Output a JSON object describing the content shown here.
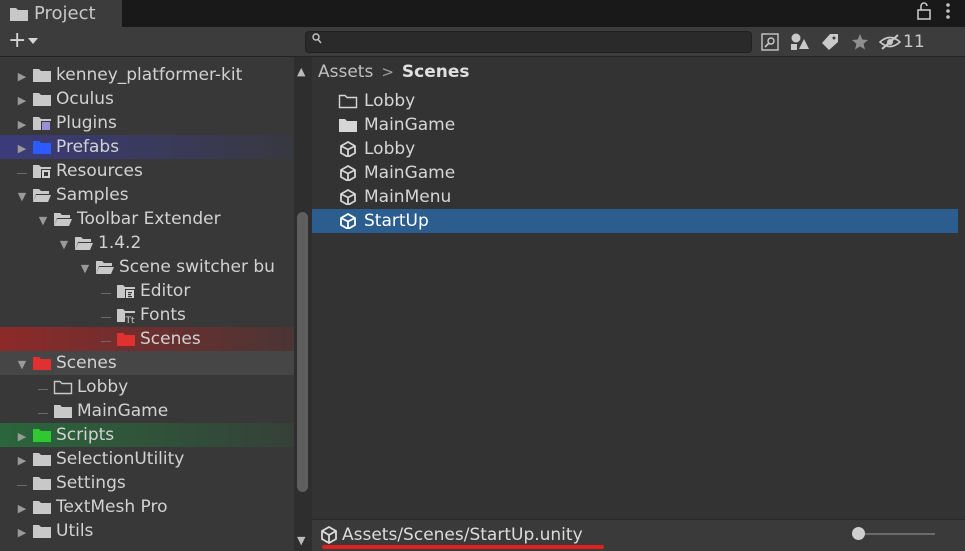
{
  "window": {
    "tab_title": "Project"
  },
  "toolbar": {
    "add_label": "+",
    "hidden_count": "11"
  },
  "search": {
    "placeholder": ""
  },
  "tree": {
    "items": [
      {
        "label": "kenney_platformer-kit",
        "depth": 0,
        "arrow": "right",
        "icon": "folder",
        "color": "#c8c8c8"
      },
      {
        "label": "Oculus",
        "depth": 0,
        "arrow": "right",
        "icon": "folder",
        "color": "#c8c8c8"
      },
      {
        "label": "Plugins",
        "depth": 0,
        "arrow": "right",
        "icon": "plugins-folder",
        "color": "#c8c8c8"
      },
      {
        "label": "Prefabs",
        "depth": 0,
        "arrow": "right",
        "icon": "folder",
        "color": "#2c5cff",
        "highlight": "blue"
      },
      {
        "label": "Resources",
        "depth": 0,
        "arrow": "none",
        "icon": "resources-folder",
        "color": "#c8c8c8"
      },
      {
        "label": "Samples",
        "depth": 0,
        "arrow": "down",
        "icon": "open-folder",
        "color": "#c8c8c8"
      },
      {
        "label": "Toolbar Extender",
        "depth": 1,
        "arrow": "down",
        "icon": "open-folder",
        "color": "#c8c8c8"
      },
      {
        "label": "1.4.2",
        "depth": 2,
        "arrow": "down",
        "icon": "open-folder",
        "color": "#c8c8c8"
      },
      {
        "label": "Scene switcher bu",
        "depth": 3,
        "arrow": "down",
        "icon": "open-folder",
        "color": "#c8c8c8"
      },
      {
        "label": "Editor",
        "depth": 4,
        "arrow": "none",
        "icon": "editor-folder",
        "color": "#c8c8c8"
      },
      {
        "label": "Fonts",
        "depth": 4,
        "arrow": "none",
        "icon": "fonts-folder",
        "color": "#c8c8c8"
      },
      {
        "label": "Scenes",
        "depth": 4,
        "arrow": "none",
        "icon": "folder",
        "color": "#e03030",
        "highlight": "red"
      },
      {
        "label": "Scenes",
        "depth": 0,
        "arrow": "down",
        "icon": "folder",
        "color": "#e03030",
        "highlight": "gray"
      },
      {
        "label": "Lobby",
        "depth": 1,
        "arrow": "none",
        "icon": "empty-folder",
        "color": "#c8c8c8"
      },
      {
        "label": "MainGame",
        "depth": 1,
        "arrow": "none",
        "icon": "folder",
        "color": "#c8c8c8"
      },
      {
        "label": "Scripts",
        "depth": 0,
        "arrow": "right",
        "icon": "folder",
        "color": "#30c830",
        "highlight": "green"
      },
      {
        "label": "SelectionUtility",
        "depth": 0,
        "arrow": "right",
        "icon": "folder",
        "color": "#c8c8c8"
      },
      {
        "label": "Settings",
        "depth": 0,
        "arrow": "none",
        "icon": "folder",
        "color": "#c8c8c8"
      },
      {
        "label": "TextMesh Pro",
        "depth": 0,
        "arrow": "right",
        "icon": "folder",
        "color": "#c8c8c8"
      },
      {
        "label": "Utils",
        "depth": 0,
        "arrow": "right",
        "icon": "folder",
        "color": "#c8c8c8"
      }
    ]
  },
  "breadcrumb": {
    "root": "Assets",
    "separator": ">",
    "current": "Scenes"
  },
  "assets": [
    {
      "label": "Lobby",
      "icon": "empty-folder",
      "selected": false
    },
    {
      "label": "MainGame",
      "icon": "folder",
      "selected": false
    },
    {
      "label": "Lobby",
      "icon": "unity-scene",
      "selected": false
    },
    {
      "label": "MainGame",
      "icon": "unity-scene",
      "selected": false
    },
    {
      "label": "MainMenu",
      "icon": "unity-scene",
      "selected": false
    },
    {
      "label": "StartUp",
      "icon": "unity-scene",
      "selected": true
    }
  ],
  "footer": {
    "path": "Assets/Scenes/StartUp.unity",
    "zoom": 0
  },
  "colors": {
    "selection": "#2c5d8f",
    "annotation_underline": "#e01f1f"
  }
}
